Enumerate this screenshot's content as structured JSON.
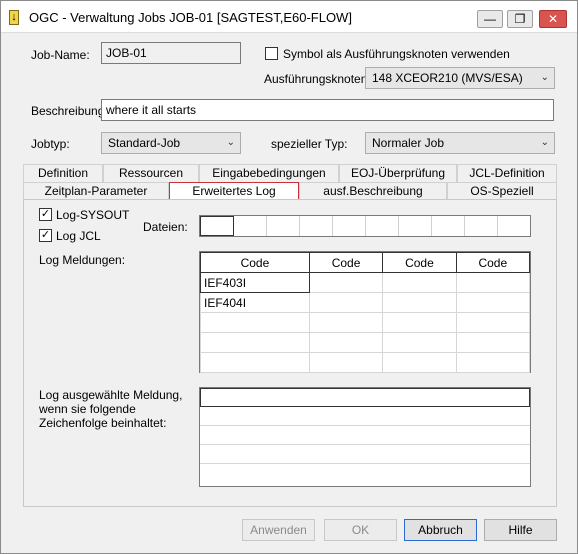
{
  "window": {
    "title": "OGC - Verwaltung Jobs JOB-01 [SAGTEST,E60-FLOW]",
    "minimize": "—",
    "maximize": "❐",
    "close": "✕"
  },
  "form": {
    "job_name_label": "Job-Name:",
    "job_name_value": "JOB-01",
    "symbol_checkbox_label": "Symbol als Ausführungsknoten verwenden",
    "exec_node_label": "Ausführungsknoten:",
    "exec_node_value": "148   XCEOR210 (MVS/ESA)",
    "description_label": "Beschreibung:",
    "description_value": "where it all starts",
    "jobtype_label": "Jobtyp:",
    "jobtype_value": "Standard-Job",
    "special_type_label": "spezieller Typ:",
    "special_type_value": "Normaler Job"
  },
  "tabs_row1": [
    "Definition",
    "Ressourcen",
    "Eingabebedingungen",
    "EOJ-Überprüfung",
    "JCL-Definition"
  ],
  "tabs_row2": [
    "Zeitplan-Parameter",
    "Erweitertes Log",
    "ausf.Beschreibung",
    "OS-Speziell"
  ],
  "panel": {
    "log_sysout_label": "Log-SYSOUT",
    "log_jcl_label": "Log JCL",
    "files_label": "Dateien:",
    "log_messages_label": "Log Meldungen:",
    "columns": [
      "Code",
      "Code",
      "Code",
      "Code"
    ],
    "rows": [
      [
        "IEF403I",
        "",
        "",
        ""
      ],
      [
        "IEF404I",
        "",
        "",
        ""
      ],
      [
        "",
        "",
        "",
        ""
      ],
      [
        "",
        "",
        "",
        ""
      ],
      [
        "",
        "",
        "",
        ""
      ]
    ],
    "log_string_label_1": "Log ausgewählte Meldung,",
    "log_string_label_2": "wenn sie folgende",
    "log_string_label_3": "Zeichenfolge  beinhaltet:"
  },
  "buttons": {
    "apply": "Anwenden",
    "ok": "OK",
    "cancel": "Abbruch",
    "help": "Hilfe"
  }
}
